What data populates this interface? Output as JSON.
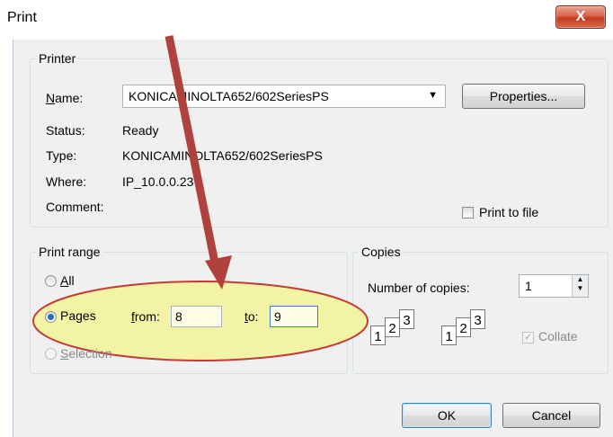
{
  "window": {
    "title": "Print",
    "close_glyph": "X"
  },
  "printer": {
    "group_label": "Printer",
    "name_label": "Name:",
    "name_value": "KONICAMINOLTA652/602SeriesPS",
    "properties_button": "Properties...",
    "status_label": "Status:",
    "status_value": "Ready",
    "type_label": "Type:",
    "type_value": "KONICAMINOLTA652/602SeriesPS",
    "where_label": "Where:",
    "where_value": "IP_10.0.0.23",
    "comment_label": "Comment:",
    "print_to_file_label": "Print to file"
  },
  "print_range": {
    "group_label": "Print range",
    "all_label": "All",
    "pages_label": "Pages",
    "from_label": "from:",
    "from_value": "8",
    "to_label": "to:",
    "to_value": "9",
    "selection_label": "Selection"
  },
  "copies": {
    "group_label": "Copies",
    "number_label": "Number of copies:",
    "number_value": "1",
    "collate_label": "Collate",
    "collate_pages": [
      "1",
      "2",
      "3"
    ]
  },
  "buttons": {
    "ok": "OK",
    "cancel": "Cancel"
  },
  "annotation": {
    "arrow_color": "#b0413c",
    "ellipse_color": "#c43a36",
    "ellipse_fill": "#f3f3a6"
  }
}
